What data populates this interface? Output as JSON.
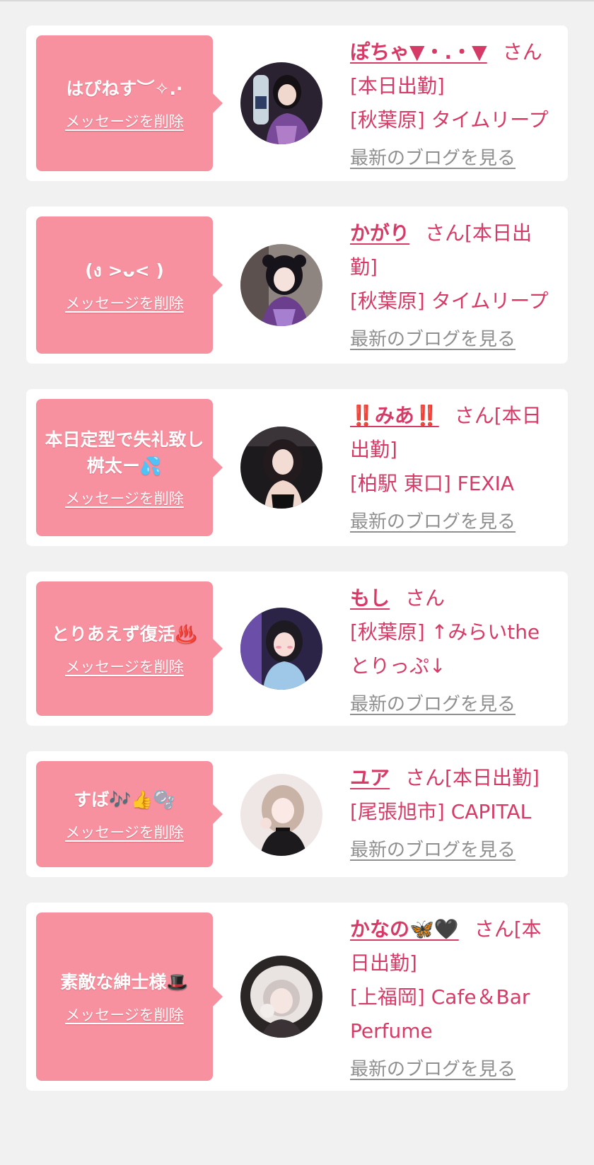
{
  "delete_label": "メッセージを削除",
  "blog_label": "最新のブログを見る",
  "honorific": "さん",
  "items": [
    {
      "message": "はぴねす︶✧.·",
      "name": "ぽちゃ▼・.・▼",
      "status": "[本日出勤]",
      "location": "[秋葉原] タイムリープ"
    },
    {
      "message": "(ง >ᴗ< )",
      "name": "かがり",
      "status": "[本日出勤]",
      "location": "[秋葉原] タイムリープ"
    },
    {
      "message": "本日定型で失礼致し桝太ー💦",
      "name": "‼️みあ‼️",
      "status": "[本日出勤]",
      "location": "[柏駅 東口] FEXIA"
    },
    {
      "message": "とりあえず復活♨️",
      "name": "もし",
      "status": "",
      "location": "[秋葉原] ↑みらいtheとりっぷ↓"
    },
    {
      "message": "すば🎶👍🫧",
      "name": "ユア",
      "status": "[本日出勤]",
      "location": "[尾張旭市] CAPITAL"
    },
    {
      "message": "素敵な紳士様🎩",
      "name": "かなの🦋🖤",
      "status": "[本日出勤]",
      "location": "[上福岡] Cafe＆Bar Perfume"
    }
  ],
  "colors": {
    "bubble": "#f7919f",
    "accent": "#d63a66",
    "link_gray": "#8f8f8f",
    "background": "#f1f1f1"
  }
}
